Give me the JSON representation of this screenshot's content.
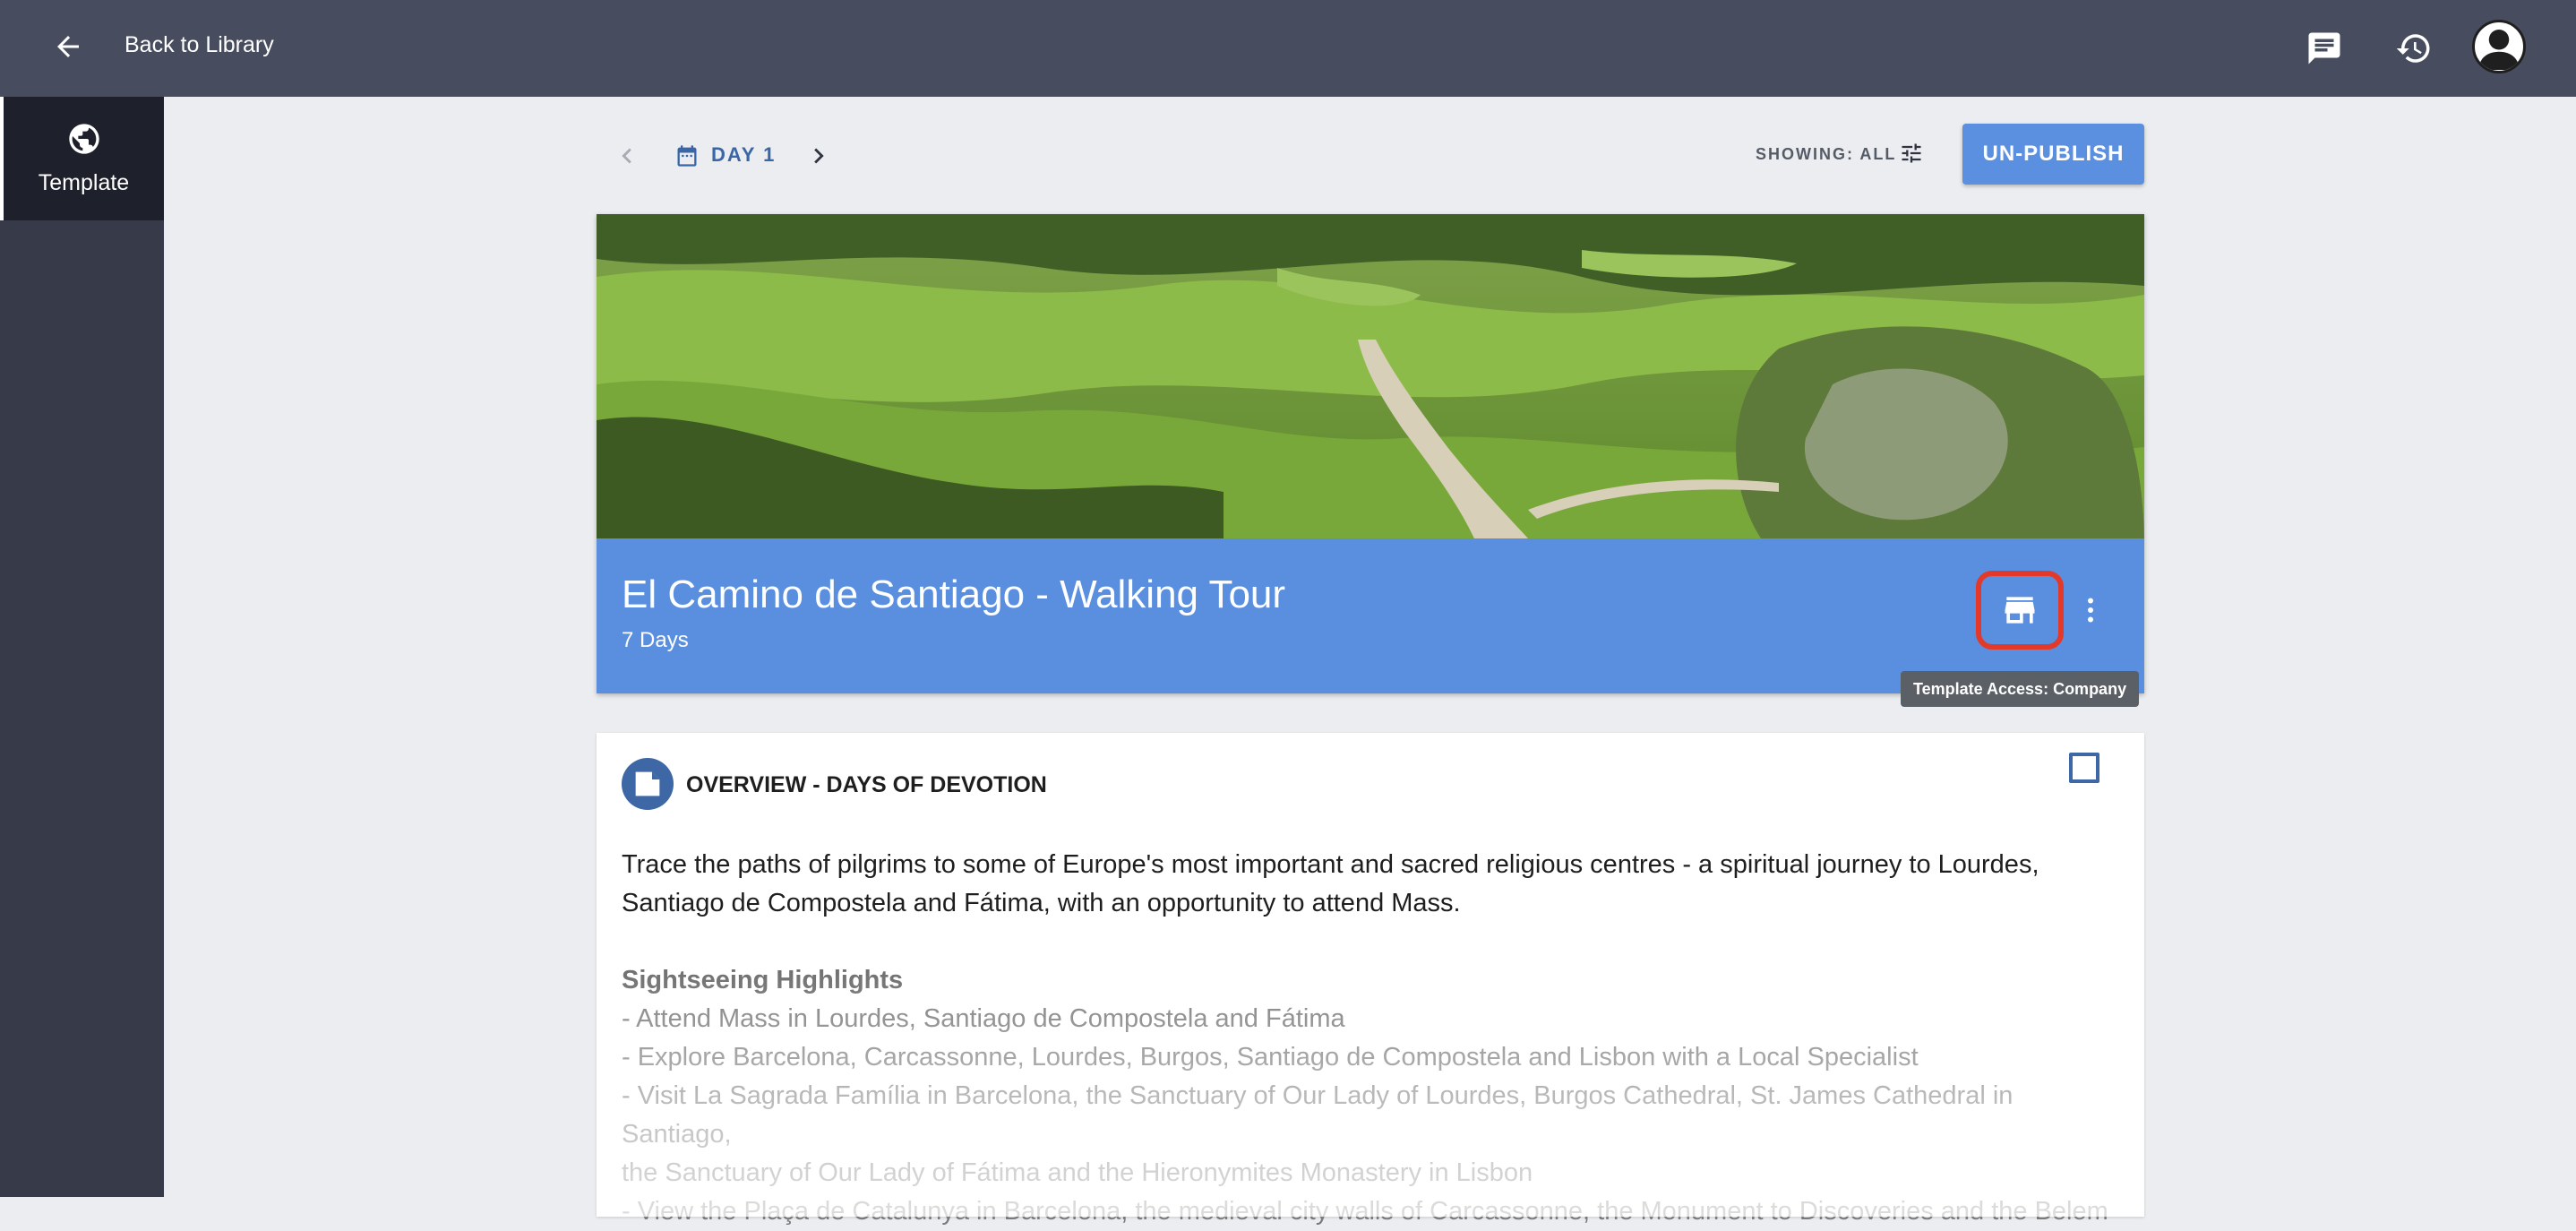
{
  "topbar": {
    "back_label": "Back to Library",
    "icons": [
      "back-arrow-icon",
      "chat-icon",
      "history-icon",
      "account-icon"
    ]
  },
  "sidebar": {
    "items": [
      {
        "label": "Template",
        "icon": "globe-icon",
        "active": true
      }
    ]
  },
  "toolbar": {
    "day_label": "DAY 1",
    "showing_label": "SHOWING: ALL",
    "unpublish_label": "UN-PUBLISH"
  },
  "hero": {
    "title": "El Camino de Santiago - Walking Tour",
    "subtitle": "7 Days",
    "image": "landscape-photo",
    "band_color": "#5a8fdf",
    "tooltip": "Template Access: Company"
  },
  "overview": {
    "title": "OVERVIEW - DAYS OF DEVOTION",
    "intro_line1": "Trace the paths of pilgrims to some of Europe's most important and sacred religious centres - a spiritual journey to Lourdes,",
    "intro_line2": "Santiago de Compostela and Fátima, with an opportunity to attend Mass.",
    "highlights_heading": "Sightseeing Highlights",
    "highlights": [
      "- Attend Mass in Lourdes, Santiago de Compostela and Fátima",
      "- Explore Barcelona, Carcassonne, Lourdes, Burgos, Santiago de Compostela and Lisbon with a Local Specialist",
      "- Visit La Sagrada Família in Barcelona, the Sanctuary of Our Lady of Lourdes, Burgos Cathedral, St. James Cathedral in Santiago,",
      "the Sanctuary of Our Lady of Fátima and the Hieronymites Monastery in Lisbon",
      "- View the Plaça de Catalunya in Barcelona, the medieval city walls of Carcassonne, the Monument to Discoveries and the Belem"
    ]
  },
  "colors": {
    "topbar": "#474d5e",
    "sidebar": "#373b49",
    "accent": "#5b8fe0",
    "highlight_ring": "#e2392b"
  }
}
